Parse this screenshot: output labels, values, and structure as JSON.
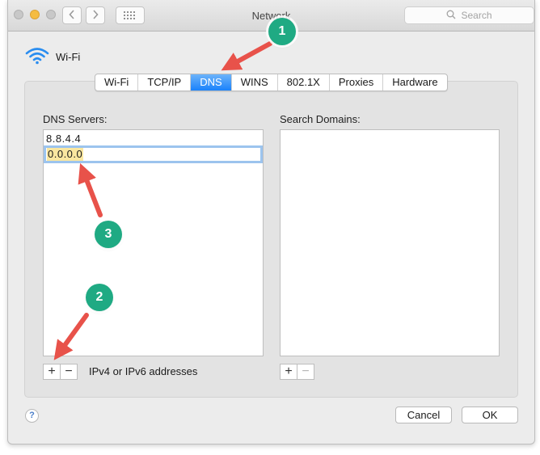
{
  "window": {
    "title": "Network"
  },
  "search": {
    "placeholder": "Search"
  },
  "interface": {
    "name": "Wi-Fi"
  },
  "tabs": [
    {
      "label": "Wi-Fi",
      "active": false
    },
    {
      "label": "TCP/IP",
      "active": false
    },
    {
      "label": "DNS",
      "active": true
    },
    {
      "label": "WINS",
      "active": false
    },
    {
      "label": "802.1X",
      "active": false
    },
    {
      "label": "Proxies",
      "active": false
    },
    {
      "label": "Hardware",
      "active": false
    }
  ],
  "dns": {
    "label": "DNS Servers:",
    "entries": [
      "8.8.4.4"
    ],
    "editing_value": "0.0.0.0",
    "add": "+",
    "remove": "−",
    "hint": "IPv4 or IPv6 addresses"
  },
  "search_domains": {
    "label": "Search Domains:",
    "entries": [],
    "add": "+",
    "remove": "−"
  },
  "buttons": {
    "help": "?",
    "cancel": "Cancel",
    "ok": "OK"
  },
  "annotations": [
    "1",
    "2",
    "3"
  ],
  "colors": {
    "accent": "#1a82fb",
    "badge": "#1faa83",
    "arrow": "#e8524a"
  }
}
